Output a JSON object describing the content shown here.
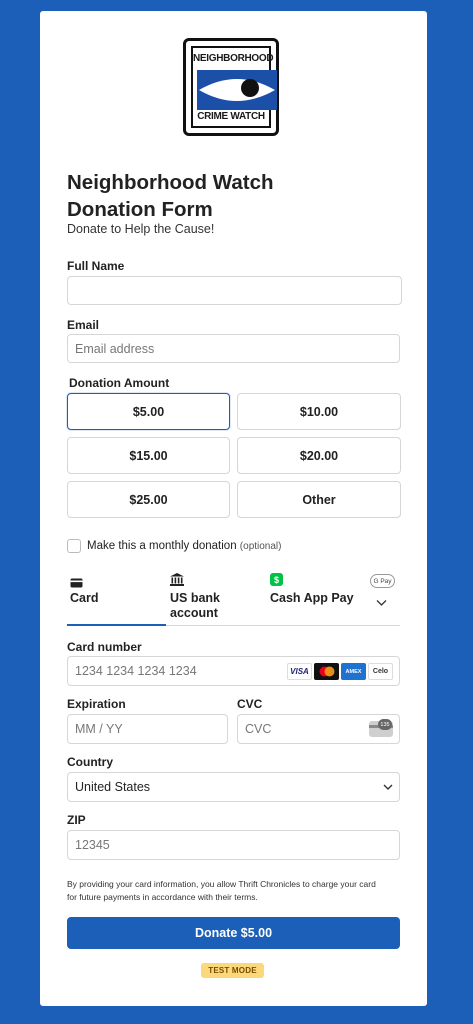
{
  "logo": {
    "top_text": "NEIGHBORHOOD",
    "bottom_text": "CRIME WATCH"
  },
  "form": {
    "title": "Neighborhood Watch Donation Form",
    "subtitle": "Donate to Help the Cause!"
  },
  "fields": {
    "full_name": {
      "label": "Full Name",
      "value": "",
      "placeholder": ""
    },
    "email": {
      "label": "Email",
      "placeholder": "Email address"
    }
  },
  "donation": {
    "label": "Donation Amount",
    "selected": "$5.00",
    "options": [
      "$5.00",
      "$10.00",
      "$15.00",
      "$20.00",
      "$25.00",
      "Other"
    ]
  },
  "monthly": {
    "label": "Make this a monthly donation",
    "optional": "(optional)",
    "checked": false
  },
  "payment_tabs": [
    {
      "label": "Card",
      "icon": "credit-card-icon",
      "active": true
    },
    {
      "label": "US bank account",
      "icon": "bank-icon",
      "active": false
    },
    {
      "label": "Cash App Pay",
      "icon": "cash-app-icon",
      "active": false
    }
  ],
  "more_methods": {
    "icon": "google-pay-icon",
    "badge": "G Pay"
  },
  "card": {
    "number_label": "Card number",
    "number_placeholder": "1234 1234 1234 1234",
    "brands": [
      "VISA",
      "Mastercard",
      "AMEX",
      "Celo"
    ],
    "expiration_label": "Expiration",
    "expiration_placeholder": "MM / YY",
    "cvc_label": "CVC",
    "cvc_placeholder": "CVC",
    "cvc_badge": "135",
    "country_label": "Country",
    "country_value": "United States",
    "zip_label": "ZIP",
    "zip_value": "12345"
  },
  "disclaimer": "By providing your card information, you allow Thrift Chronicles to charge your card for future payments in accordance with their terms.",
  "submit_label": "Donate $5.00",
  "test_mode": "TEST MODE",
  "colors": {
    "accent": "#1b5fb8",
    "background": "#1b5fb8",
    "badge": "#fbd97a",
    "cash_app": "#00c244"
  }
}
